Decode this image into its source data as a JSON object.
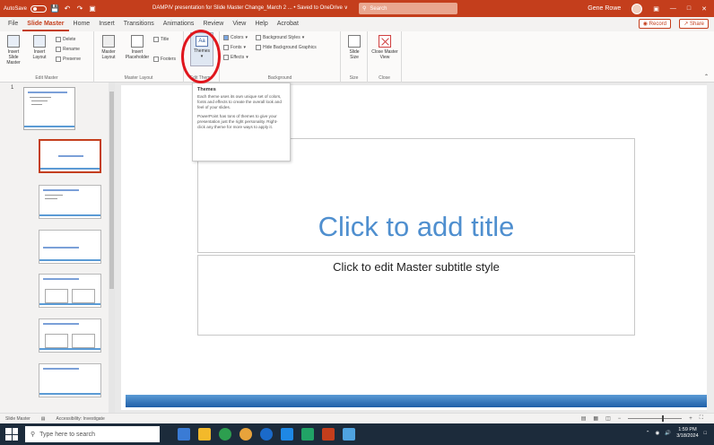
{
  "titlebar": {
    "autosave_label": "AutoSave",
    "autosave_state": "Off",
    "doc_title": "DAMPIV presentation for Slide Master Change_March 2 ... • Saved to OneDrive ∨",
    "search_placeholder": "Search",
    "user_name": "Gene Rowe"
  },
  "tabs": [
    "File",
    "Slide Master",
    "Home",
    "Insert",
    "Transitions",
    "Animations",
    "Review",
    "View",
    "Help",
    "Acrobat"
  ],
  "active_tab": "Slide Master",
  "record_label": "Record",
  "share_label": "Share",
  "ribbon": {
    "edit_master": {
      "label": "Edit Master",
      "insert_slide_master": "Insert Slide Master",
      "insert_layout": "Insert Layout",
      "delete": "Delete",
      "rename": "Rename",
      "preserve": "Preserve"
    },
    "master_layout": {
      "label": "Master Layout",
      "master_layout_btn": "Master Layout",
      "insert_placeholder": "Insert Placeholder",
      "title_check": "Title",
      "footers_check": "Footers"
    },
    "edit_theme": {
      "label": "Edit Theme",
      "themes": "Themes"
    },
    "background": {
      "label": "Background",
      "colors": "Colors",
      "fonts": "Fonts",
      "effects": "Effects",
      "background_styles": "Background Styles",
      "hide_bg_graphics": "Hide Background Graphics"
    },
    "size": {
      "label": "Size",
      "slide_size": "Slide Size"
    },
    "close": {
      "label": "Close",
      "close_master_view": "Close Master View"
    }
  },
  "tooltip": {
    "title": "Themes",
    "p1": "Each theme uses its own unique set of colors, fonts and effects to create the overall look and feel of your slides.",
    "p2": "PowerPoint has tons of themes to give your presentation just the right personality. Right-click any theme for more ways to apply it."
  },
  "slide": {
    "title": "Click to add title",
    "subtitle": "Click to edit Master subtitle style"
  },
  "thumbnail_number": "1",
  "statusbar": {
    "view": "Slide Master",
    "accessibility": "Accessibility: Investigate"
  },
  "taskbar": {
    "search_placeholder": "Type here to search",
    "time": "1:59 PM",
    "date": "3/18/2024"
  },
  "colors": {
    "accent": "#c43e1c",
    "title_blue": "#4f8fcf",
    "highlight_circle": "#e0161d"
  }
}
